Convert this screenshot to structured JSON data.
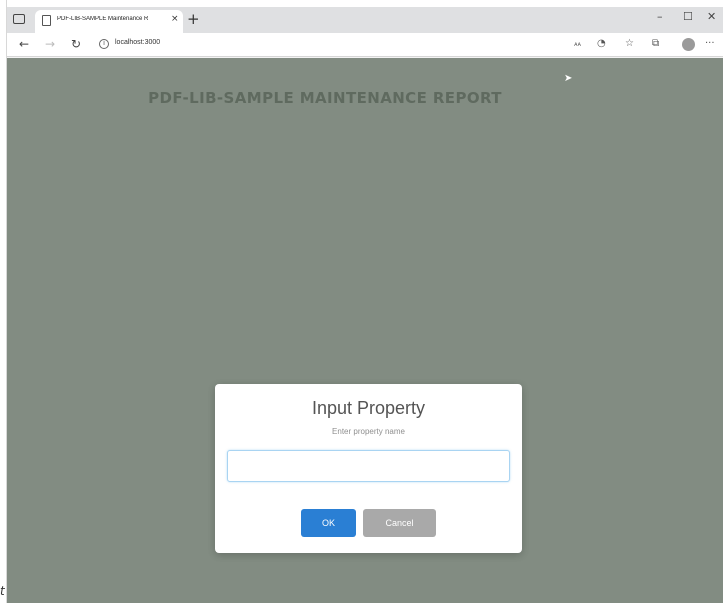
{
  "browser": {
    "tab_title": "PDF-LIB-SAMPLE Maintenance R",
    "tab_close": "×",
    "new_tab": "+",
    "window_controls": {
      "minimize": "–",
      "maximize": "☐",
      "close": "✕"
    },
    "nav": {
      "back": "←",
      "forward": "→",
      "refresh": "↻"
    },
    "info_glyph": "i",
    "url": "localhost:3000",
    "toolbar_icons": [
      "reader-view-icon",
      "tracking-icon",
      "favorites-icon",
      "collections-icon",
      "profile-icon",
      "more-icon"
    ],
    "toolbar_glyphs": {
      "reader": "ᴀᴀ",
      "favorites": "☆",
      "collections": "⧉",
      "more": "···"
    }
  },
  "page": {
    "title": "PDF-LIB-SAMPLE MAINTENANCE REPORT",
    "overlay_color": "#828c82"
  },
  "dialog": {
    "title": "Input Property",
    "subtitle": "Enter property name",
    "input_value": "",
    "ok_label": "OK",
    "cancel_label": "Cancel",
    "ok_color": "#2a7fd4",
    "cancel_color": "#a9a9a9"
  },
  "corner_glyph": "t"
}
